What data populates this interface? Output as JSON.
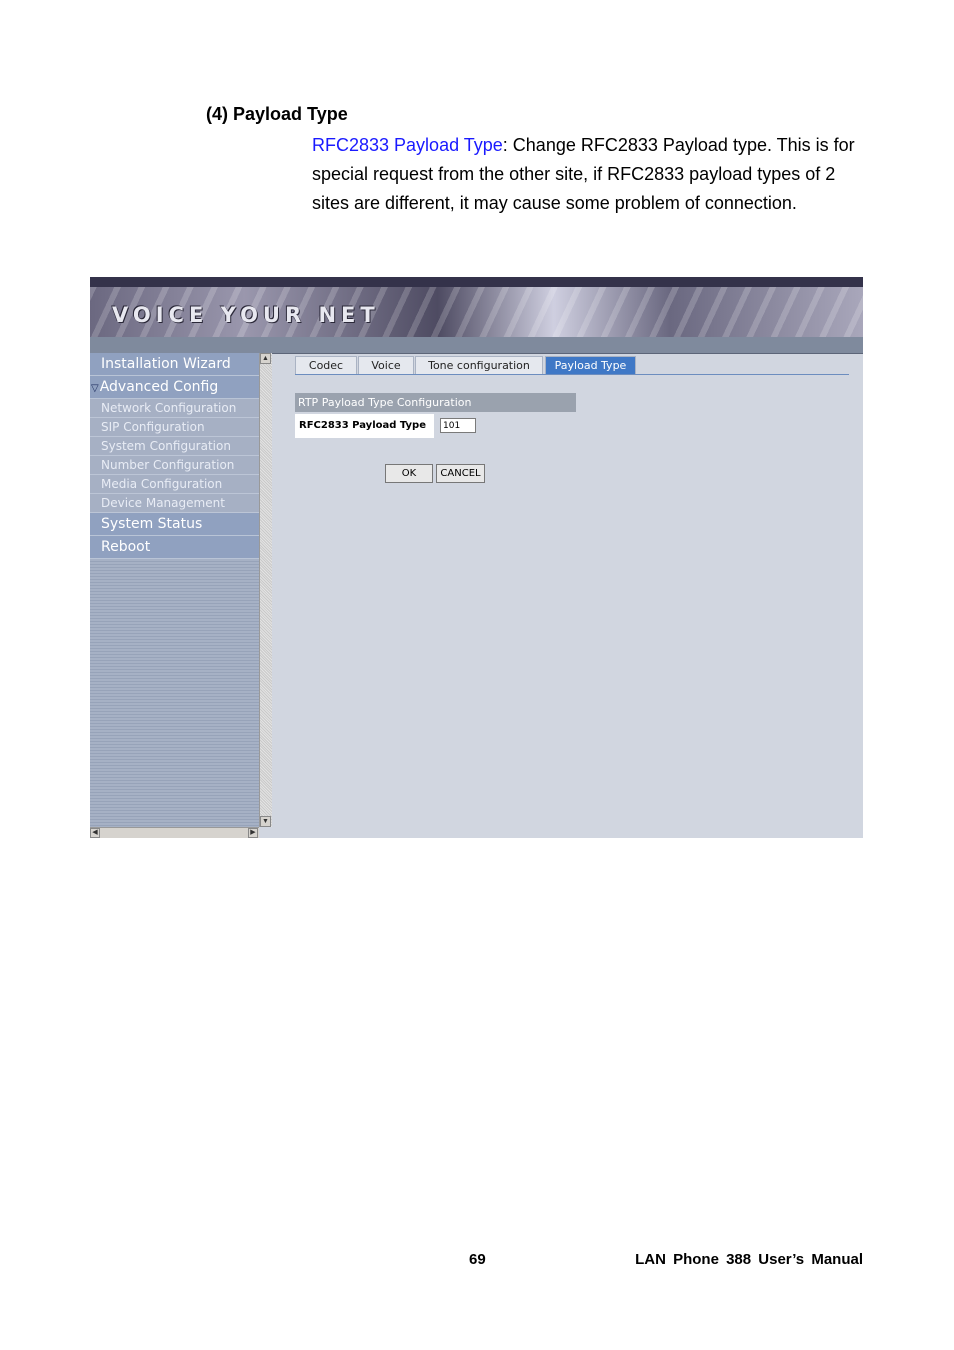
{
  "doc": {
    "heading": "(4) Payload Type",
    "term": "RFC2833 Payload Type",
    "description": ": Change RFC2833 Payload type. This is for special request from the other site, if RFC2833 payload types of 2 sites are different, it may cause some problem of connection.",
    "page_number": "69",
    "manual_title": "LAN Phone 388 User’s Manual"
  },
  "app": {
    "banner_title": "VOICE YOUR NET",
    "sidebar": {
      "installation_wizard": "Installation Wizard",
      "advanced_config": "Advanced Config",
      "sub_items": [
        "Network Configuration",
        "SIP Configuration",
        "System Configuration",
        "Number Configuration",
        "Media Configuration",
        "Device Management"
      ],
      "system_status": "System Status",
      "reboot": "Reboot"
    },
    "tabs": [
      "Codec",
      "Voice",
      "Tone configuration",
      "Payload Type"
    ],
    "active_tab": "Payload Type",
    "section_title": "RTP Payload Type Configuration",
    "field": {
      "label": "RFC2833 Payload Type",
      "value": "101"
    },
    "buttons": {
      "ok": "OK",
      "cancel": "CANCEL"
    },
    "colors": {
      "active_tab": "#3f78c6",
      "link_term": "#1a1aff"
    }
  }
}
